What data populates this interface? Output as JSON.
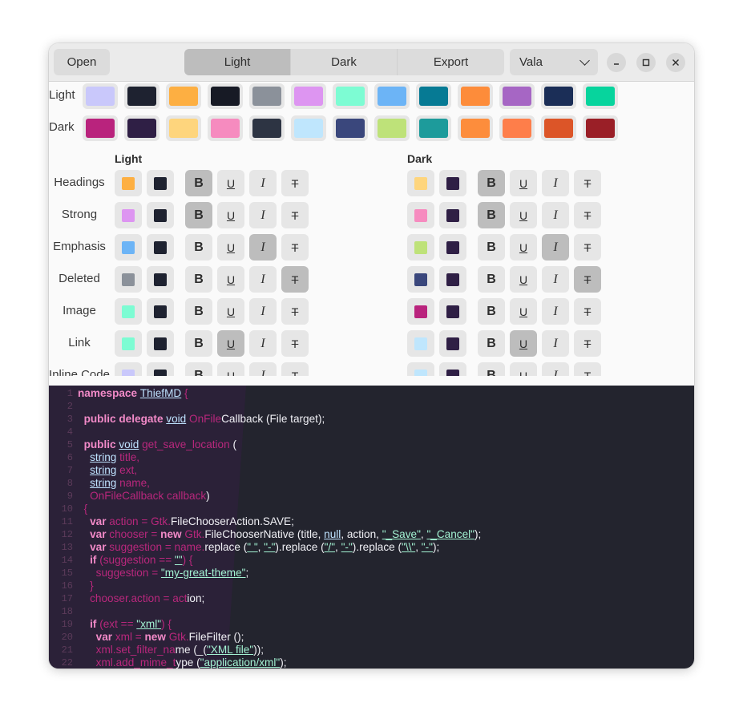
{
  "header": {
    "open_label": "Open",
    "tabs": [
      "Light",
      "Dark",
      "Export"
    ],
    "active_tab": 0,
    "language_value": "Vala",
    "minimize": "–",
    "maximize": "□",
    "close": "✕"
  },
  "palette": {
    "light_label": "Light",
    "dark_label": "Dark",
    "light_colors": [
      "#c9c8fb",
      "#1e2230",
      "#fdaf42",
      "#171a25",
      "#8b919a",
      "#dd95f1",
      "#7dfcd3",
      "#6cb4f6",
      "#067a94",
      "#fd8c3a",
      "#a666c4",
      "#1b2e57",
      "#07d49d"
    ],
    "dark_colors": [
      "#b9237d",
      "#2f1f45",
      "#fed57d",
      "#f68bbf",
      "#2d3443",
      "#bfe6fd",
      "#3a477c",
      "#bee279",
      "#1d9b9b",
      "#fd8d3c",
      "#fe7e4a",
      "#dc5528",
      "#9a1f27"
    ]
  },
  "styles": {
    "light_heading": "Light",
    "dark_heading": "Dark",
    "bold_glyph": "B",
    "underline_glyph": "U",
    "italic_glyph": "I",
    "strike_glyph": "T",
    "rows": [
      {
        "label": "Headings",
        "light_color": "#fdaf42",
        "light_bg": "#1e2230",
        "dark_color": "#fed57d",
        "dark_bg": "#2f1f45",
        "active": [
          "b"
        ]
      },
      {
        "label": "Strong",
        "light_color": "#dd95f1",
        "light_bg": "#1e2230",
        "dark_color": "#f68bbf",
        "dark_bg": "#2f1f45",
        "active": [
          "b"
        ]
      },
      {
        "label": "Emphasis",
        "light_color": "#6cb4f6",
        "light_bg": "#1e2230",
        "dark_color": "#bee279",
        "dark_bg": "#2f1f45",
        "active": [
          "i"
        ]
      },
      {
        "label": "Deleted",
        "light_color": "#8b919a",
        "light_bg": "#1e2230",
        "dark_color": "#3a477c",
        "dark_bg": "#2f1f45",
        "active": [
          "s"
        ]
      },
      {
        "label": "Image",
        "light_color": "#7dfcd3",
        "light_bg": "#1e2230",
        "dark_color": "#b9237d",
        "dark_bg": "#2f1f45",
        "active": []
      },
      {
        "label": "Link",
        "light_color": "#7dfcd3",
        "light_bg": "#1e2230",
        "dark_color": "#bfe6fd",
        "dark_bg": "#2f1f45",
        "active": [
          "u"
        ]
      },
      {
        "label": "Inline Code",
        "light_color": "#c9c8fb",
        "light_bg": "#1e2230",
        "dark_color": "#bfe6fd",
        "dark_bg": "#2f1f45",
        "active": []
      }
    ]
  },
  "editor": {
    "line_numbers": [
      "1",
      "2",
      "3",
      "4",
      "5",
      "6",
      "7",
      "8",
      "9",
      "10",
      "11",
      "12",
      "13",
      "14",
      "15",
      "16",
      "17",
      "18",
      "19",
      "20",
      "21",
      "22"
    ],
    "lines": [
      [
        [
          "kw",
          "namespace "
        ],
        [
          "ty",
          "ThiefMD"
        ],
        [
          "id",
          " {"
        ]
      ],
      [],
      [
        [
          "pl",
          "  "
        ],
        [
          "kw",
          "public delegate "
        ],
        [
          "ty",
          "void"
        ],
        [
          "id",
          " OnFile"
        ],
        [
          "pl",
          "Callback (File target);"
        ]
      ],
      [],
      [
        [
          "pl",
          "  "
        ],
        [
          "kw",
          "public "
        ],
        [
          "ty",
          "void"
        ],
        [
          "id",
          " get_save_location "
        ],
        [
          "pl",
          "("
        ]
      ],
      [
        [
          "pl",
          "    "
        ],
        [
          "ty",
          "string"
        ],
        [
          "id",
          " title,"
        ]
      ],
      [
        [
          "pl",
          "    "
        ],
        [
          "ty",
          "string"
        ],
        [
          "id",
          " ext,"
        ]
      ],
      [
        [
          "pl",
          "    "
        ],
        [
          "ty",
          "string"
        ],
        [
          "id",
          " name,"
        ]
      ],
      [
        [
          "pl",
          "    "
        ],
        [
          "id",
          "OnFileCallback callback"
        ],
        [
          "pl",
          ")"
        ]
      ],
      [
        [
          "pl",
          "  "
        ],
        [
          "id",
          "{"
        ]
      ],
      [
        [
          "pl",
          "    "
        ],
        [
          "kw",
          "var "
        ],
        [
          "id",
          "action = Gtk."
        ],
        [
          "pl",
          "FileChooserAction.SAVE;"
        ]
      ],
      [
        [
          "pl",
          "    "
        ],
        [
          "kw",
          "var "
        ],
        [
          "id",
          "chooser = "
        ],
        [
          "kw",
          "new "
        ],
        [
          "id",
          "Gtk."
        ],
        [
          "pl",
          "FileChooserNative (title, "
        ],
        [
          "ty",
          "null"
        ],
        [
          "pl",
          ", action, "
        ],
        [
          "str",
          "\"_Save\""
        ],
        [
          "pl",
          ", "
        ],
        [
          "str",
          "\"_Cancel\""
        ],
        [
          "pl",
          ");"
        ]
      ],
      [
        [
          "pl",
          "    "
        ],
        [
          "kw",
          "var "
        ],
        [
          "id",
          "suggestion = name."
        ],
        [
          "pl",
          "replace ("
        ],
        [
          "str",
          "\" \""
        ],
        [
          "pl",
          ", "
        ],
        [
          "str",
          "\"-\""
        ],
        [
          "pl",
          ").replace ("
        ],
        [
          "str",
          "\"/\""
        ],
        [
          "pl",
          ", "
        ],
        [
          "str",
          "\"-\""
        ],
        [
          "pl",
          ").replace ("
        ],
        [
          "str",
          "\"\\\\\""
        ],
        [
          "pl",
          ", "
        ],
        [
          "str",
          "\"-\""
        ],
        [
          "pl",
          ");"
        ]
      ],
      [
        [
          "pl",
          "    "
        ],
        [
          "kw",
          "if "
        ],
        [
          "id",
          "(suggestion == "
        ],
        [
          "str",
          "\"\""
        ],
        [
          "id",
          ") {"
        ]
      ],
      [
        [
          "pl",
          "      "
        ],
        [
          "id",
          "suggestion = "
        ],
        [
          "str",
          "\"my-great-theme\""
        ],
        [
          "pl",
          ";"
        ]
      ],
      [
        [
          "pl",
          "    "
        ],
        [
          "id",
          "}"
        ]
      ],
      [
        [
          "pl",
          "    "
        ],
        [
          "id",
          "chooser.action = act"
        ],
        [
          "pl",
          "ion;"
        ]
      ],
      [],
      [
        [
          "pl",
          "    "
        ],
        [
          "kw",
          "if "
        ],
        [
          "id",
          "(ext == "
        ],
        [
          "str",
          "\"xml\""
        ],
        [
          "id",
          ") {"
        ]
      ],
      [
        [
          "pl",
          "      "
        ],
        [
          "kw",
          "var "
        ],
        [
          "id",
          "xml = "
        ],
        [
          "kw",
          "new "
        ],
        [
          "id",
          "Gtk."
        ],
        [
          "pl",
          "FileFilter ();"
        ]
      ],
      [
        [
          "pl",
          "      "
        ],
        [
          "id",
          "xml.set_filter_na"
        ],
        [
          "pl",
          "me (_("
        ],
        [
          "str",
          "\"XML file\""
        ],
        [
          "pl",
          "));"
        ]
      ],
      [
        [
          "pl",
          "      "
        ],
        [
          "id",
          "xml.add_mime_t"
        ],
        [
          "pl",
          "ype ("
        ],
        [
          "str",
          "\"application/xml\""
        ],
        [
          "pl",
          ");"
        ]
      ]
    ]
  }
}
